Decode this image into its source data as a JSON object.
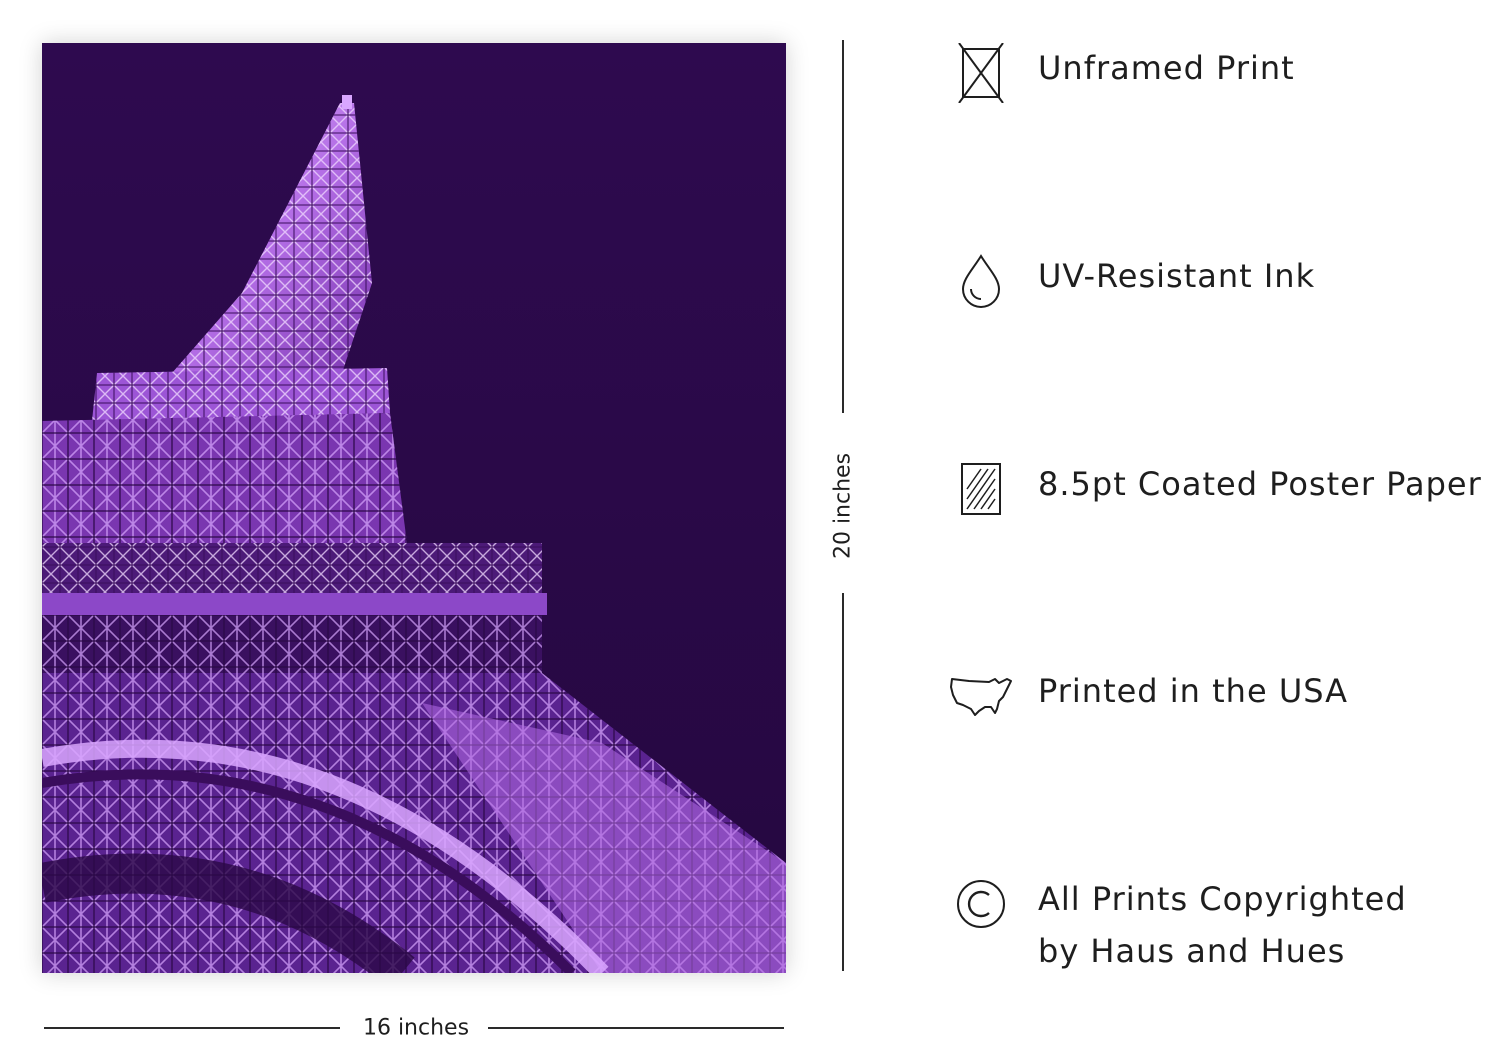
{
  "dimensions": {
    "height_label": "20 inches",
    "width_label": "16 inches"
  },
  "poster": {
    "sky_color": "#2e0a4f",
    "tower_color": "#b46ee6",
    "tower_glow_color": "#e0b8ff"
  },
  "features": [
    {
      "icon": "unframed-box-icon",
      "label": "Unframed Print"
    },
    {
      "icon": "ink-drop-icon",
      "label": "UV-Resistant Ink"
    },
    {
      "icon": "paper-texture-icon",
      "label": "8.5pt Coated Poster Paper"
    },
    {
      "icon": "usa-map-icon",
      "label": "Printed in the USA"
    },
    {
      "icon": "copyright-icon",
      "label_line1": "All Prints Copyrighted",
      "label_line2": "by Haus and Hues"
    }
  ]
}
